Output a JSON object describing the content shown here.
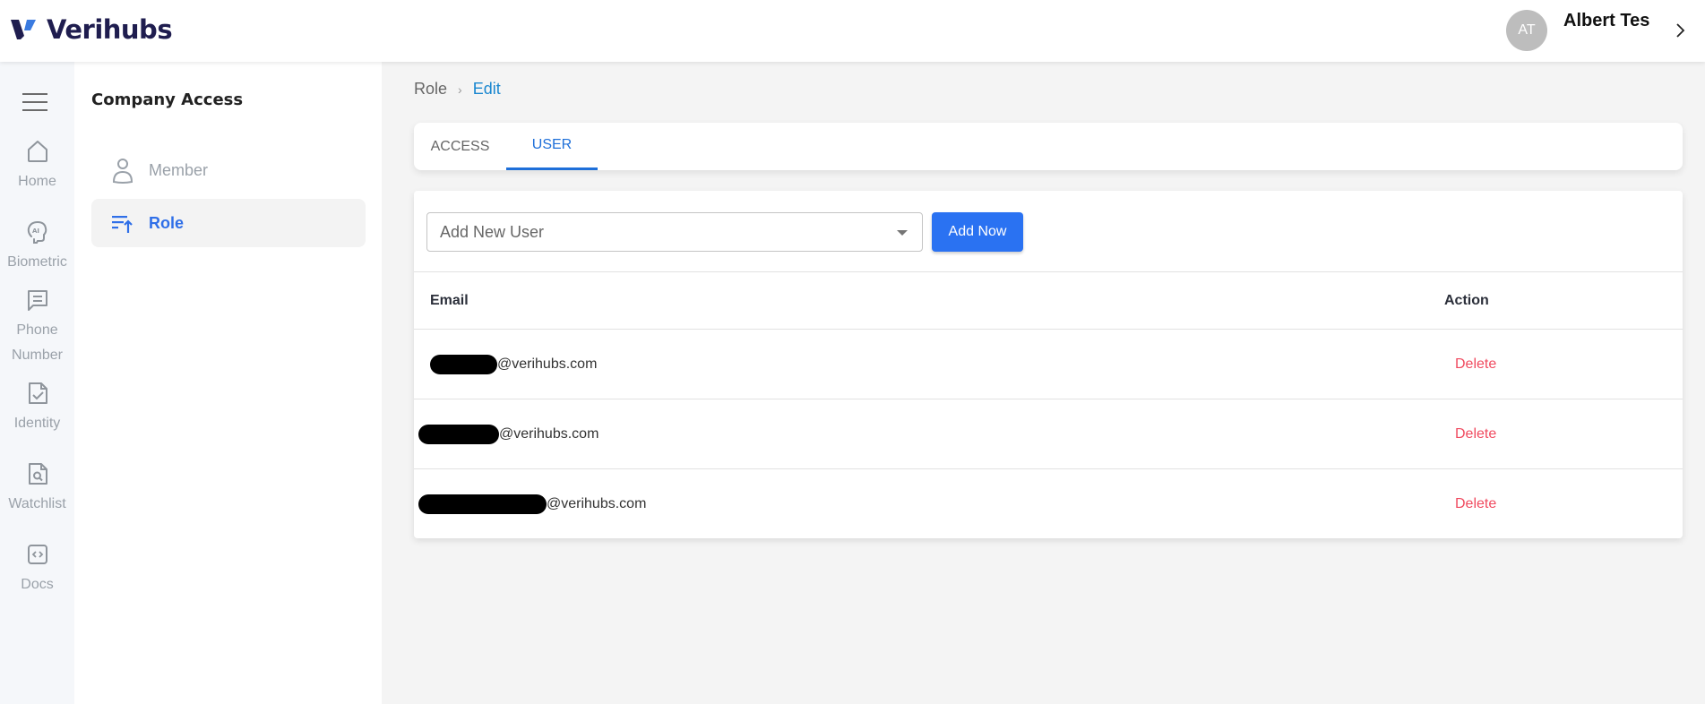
{
  "header": {
    "brand": "Verihubs",
    "brand_colors": {
      "dark": "#1f1d4f",
      "accent": "#3a7be0"
    },
    "user_initials": "AT",
    "user_name": "Albert Tes"
  },
  "rail": {
    "items": [
      {
        "label": "Home",
        "icon": "home-icon"
      },
      {
        "label": "Biometric",
        "icon": "ai-head-icon"
      },
      {
        "label": "Phone Number",
        "icon": "message-icon"
      },
      {
        "label": "Identity",
        "icon": "document-check-icon"
      },
      {
        "label": "Watchlist",
        "icon": "document-search-icon"
      },
      {
        "label": "Docs",
        "icon": "code-icon"
      }
    ]
  },
  "subpanel": {
    "title": "Company Access",
    "items": [
      {
        "label": "Member",
        "icon": "person-icon",
        "active": false
      },
      {
        "label": "Role",
        "icon": "sort-up-icon",
        "active": true
      }
    ]
  },
  "breadcrumb": {
    "items": [
      "Role",
      "Edit"
    ]
  },
  "tabs": [
    {
      "label": "ACCESS",
      "active": false
    },
    {
      "label": "USER",
      "active": true
    }
  ],
  "user_panel": {
    "select_placeholder": "Add New User",
    "add_button": "Add Now",
    "columns": {
      "email": "Email",
      "action": "Action"
    },
    "rows": [
      {
        "email_visible": "@verihubs.com",
        "action": "Delete"
      },
      {
        "email_visible": "@verihubs.com",
        "action": "Delete"
      },
      {
        "email_visible": "@verihubs.com",
        "action": "Delete"
      }
    ]
  },
  "colors": {
    "primary": "#2a72f2",
    "tab_active": "#1e6fd9",
    "danger": "#f04a5f",
    "link": "#1a87d0"
  }
}
